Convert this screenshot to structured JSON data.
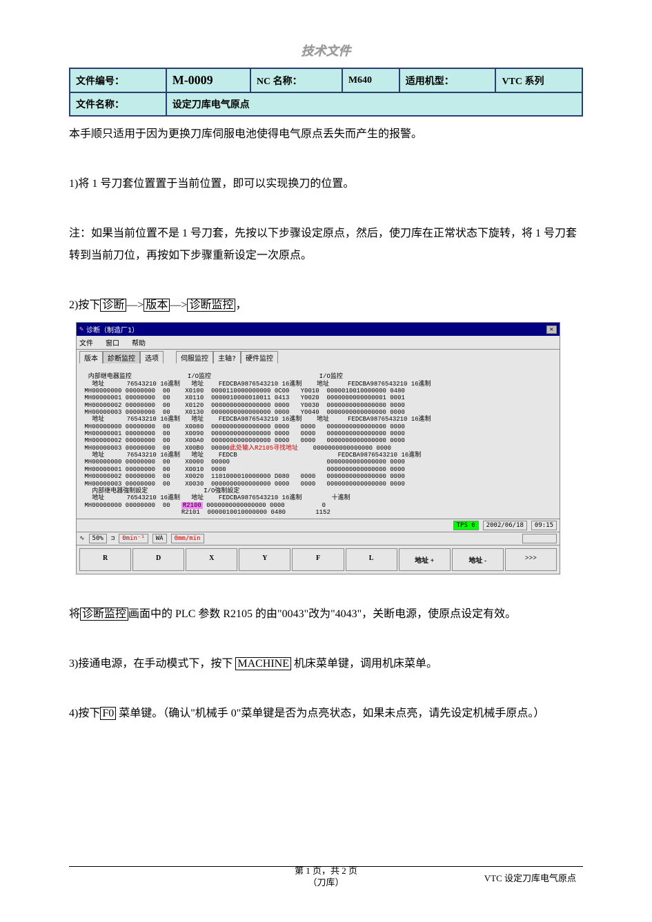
{
  "title": "技术文件",
  "header": {
    "labels": {
      "doc_no": "文件编号：",
      "nc_name": "NC 名称：",
      "model": "适用机型：",
      "doc_name": "文件名称："
    },
    "doc_no": "M-0009",
    "nc_name": "M640",
    "model": "VTC 系列",
    "doc_name": "设定刀库电气原点"
  },
  "body": {
    "intro": "本手顺只适用于因为更换刀库伺服电池使得电气原点丢失而产生的报警。",
    "step1": "1)将 1 号刀套位置置于当前位置，即可以实现换刀的位置。",
    "note": "注：如果当前位置不是 1 号刀套，先按以下步骤设定原点，然后，使刀库在正常状态下旋转，将 1 号刀套转到当前刀位，再按如下步骤重新设定一次原点。",
    "step2_a": "2)按下",
    "step2_box1": "诊断",
    "step2_sep": "—>",
    "step2_box2": "版本",
    "step2_box3": "诊断监控",
    "step2_end": "，",
    "after_shot_a": "将",
    "after_shot_box": "诊断监控",
    "after_shot_b": "画面中的 PLC 参数 R2105 的由\"0043\"改为\"4043\"，关断电源，使原点设定有效。",
    "step3_a": "3)接通电源，在手动模式下，按下",
    "step3_box": "MACHINE",
    "step3_b": "机床菜单键，调用机床菜单。",
    "step4_a": "4)按下",
    "step4_box": "F0",
    "step4_b": "菜单键。（确认\"机械手 0\"菜单键是否为点亮状态，如果未点亮，请先设定机械手原点。）"
  },
  "app": {
    "window_title": "诊断（制造厂1）",
    "menus": [
      "文件",
      "窗口",
      "帮助"
    ],
    "tabs": [
      "版本",
      "診断监控",
      "选项",
      "",
      "伺服监控",
      "主轴?",
      "硬件监控"
    ],
    "sections": {
      "col1_title": "内部继电器监控",
      "col2_title": "I/O监控",
      "col3_title": "I/O监控",
      "addr": "地址",
      "bits8": "76543210",
      "bits16": "FEDCBA9876543210",
      "hex": "16進制",
      "force1": "内部继电器強制設定",
      "force2": "I/O強制設定",
      "dec": "十進制",
      "annot": "此处输入R2105寻找地址"
    },
    "rows1": [
      {
        "a": "MH00000000",
        "b": "00000000",
        "h": "00"
      },
      {
        "a": "MH00000001",
        "b": "00000000",
        "h": "00"
      },
      {
        "a": "MH00000002",
        "b": "00000000",
        "h": "00"
      },
      {
        "a": "MH00000003",
        "b": "00000000",
        "h": "00"
      }
    ],
    "rows1b": [
      {
        "a": "MH00000000",
        "b": "00000000",
        "h": "00"
      },
      {
        "a": "MH00000001",
        "b": "00000000",
        "h": "00"
      },
      {
        "a": "MH00000002",
        "b": "00000000",
        "h": "00"
      },
      {
        "a": "MH00000003",
        "b": "00000000",
        "h": "00"
      }
    ],
    "rows1c": [
      {
        "a": "MH00000001",
        "b": "00000000",
        "h": "00"
      },
      {
        "a": "MH00000002",
        "b": "00000000",
        "h": "00"
      },
      {
        "a": "MH00000003",
        "b": "00000000",
        "h": "00"
      }
    ],
    "rows1f": [
      {
        "a": "MH00000000",
        "b": "00000000",
        "h": "00"
      }
    ],
    "rows2": [
      {
        "a": "X0100",
        "b": "0000110000000000",
        "h": "0C00"
      },
      {
        "a": "X0110",
        "b": "0000010000010011",
        "h": "0413"
      },
      {
        "a": "X0120",
        "b": "0000000000000000",
        "h": "0000"
      },
      {
        "a": "X0130",
        "b": "0000000000000000",
        "h": "0000"
      }
    ],
    "rows2b": [
      {
        "a": "X0080",
        "b": "0000000000000000",
        "h": "0000"
      },
      {
        "a": "X0090",
        "b": "0000000000000000",
        "h": "0000"
      },
      {
        "a": "X00A0",
        "b": "0000000000000000",
        "h": "0000"
      },
      {
        "a": "X00B0",
        "b": "00000",
        "h": ""
      }
    ],
    "rows2c": [
      {
        "a": "X0000",
        "b": "00000",
        "h": ""
      },
      {
        "a": "X0010",
        "b": "0000",
        "h": ""
      },
      {
        "a": "X0020",
        "b": "1101000010000000",
        "h": "D080"
      },
      {
        "a": "X0030",
        "b": "0000000000000000",
        "h": "0000"
      }
    ],
    "rows2f": [
      {
        "a": "R2100",
        "b": "0000000000000000",
        "h": "0000"
      },
      {
        "a": "R2101",
        "b": "0000010010000000",
        "h": "0480"
      }
    ],
    "rows3": [
      {
        "a": "Y0010",
        "b": "0000010010000000",
        "h": "0480"
      },
      {
        "a": "Y0020",
        "b": "0000000000000001",
        "h": "0001"
      },
      {
        "a": "Y0030",
        "b": "0000000000000000",
        "h": "0000"
      },
      {
        "a": "Y0040",
        "b": "0000000000000000",
        "h": "0000"
      }
    ],
    "rows3b": [
      {
        "a": "0000",
        "b": "0000000000000000",
        "h": "0000"
      },
      {
        "a": "0000",
        "b": "0000000000000000",
        "h": "0000"
      },
      {
        "a": "0000",
        "b": "0000000000000000",
        "h": "0000"
      },
      {
        "a": "",
        "b": "0000000000000000",
        "h": "0000"
      }
    ],
    "rows3c": [
      {
        "a": "",
        "b": "0000000000000000",
        "h": "0000"
      },
      {
        "a": "",
        "b": "0000000000000000",
        "h": "0000"
      },
      {
        "a": "0000",
        "b": "0000000000000000",
        "h": "0000"
      },
      {
        "a": "0000",
        "b": "0000000000000000",
        "h": "0000"
      }
    ],
    "rows3f": [
      {
        "d": "0"
      },
      {
        "d": "1152"
      }
    ],
    "status": {
      "pct": "50%",
      "spindle": "0min⁻¹",
      "feed_lbl": "WA",
      "feed": "0mm/min",
      "mode": "TPS 0",
      "date": "2002/06/18",
      "time": "09:15"
    },
    "buttons": [
      "R",
      "D",
      "X",
      "Y",
      "F",
      "L",
      "地址 +",
      "地址 -",
      ">>>"
    ]
  },
  "footer": {
    "page": "第 1 页，共 2 页",
    "sub": "（刀库）",
    "right": "VTC 设定刀库电气原点"
  }
}
